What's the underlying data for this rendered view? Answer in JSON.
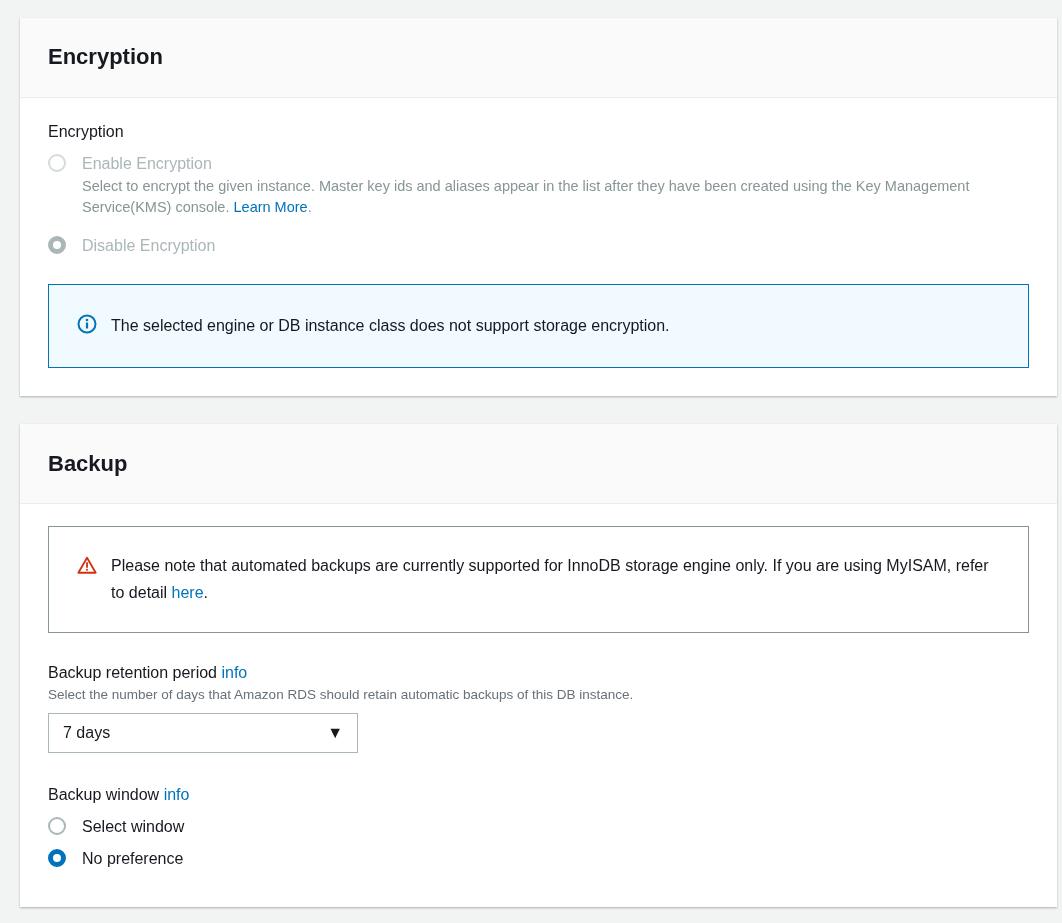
{
  "encryption": {
    "title": "Encryption",
    "field_label": "Encryption",
    "options": [
      {
        "label": "Enable Encryption",
        "selected": false,
        "disabled": true,
        "description": "Select to encrypt the given instance. Master key ids and aliases appear in the list after they have been created using the Key Management Service(KMS) console.",
        "link": "Learn More",
        "after_link": "."
      },
      {
        "label": "Disable Encryption",
        "selected": true,
        "disabled": true
      }
    ],
    "alert": {
      "kind": "info",
      "text": "The selected engine or DB instance class does not support storage encryption."
    }
  },
  "backup": {
    "title": "Backup",
    "alert": {
      "kind": "warning",
      "text": "Please note that automated backups are currently supported for InnoDB storage engine only. If you are using MyISAM, refer to detail",
      "link": "here",
      "after_link": "."
    },
    "retention": {
      "label": "Backup retention period",
      "info": "info",
      "description": "Select the number of days that Amazon RDS should retain automatic backups of this DB instance.",
      "value": "7 days",
      "caret": "▼"
    },
    "window": {
      "label": "Backup window",
      "info": "info",
      "options": [
        {
          "label": "Select window",
          "selected": false,
          "disabled": false
        },
        {
          "label": "No preference",
          "selected": true,
          "disabled": false
        }
      ]
    }
  }
}
